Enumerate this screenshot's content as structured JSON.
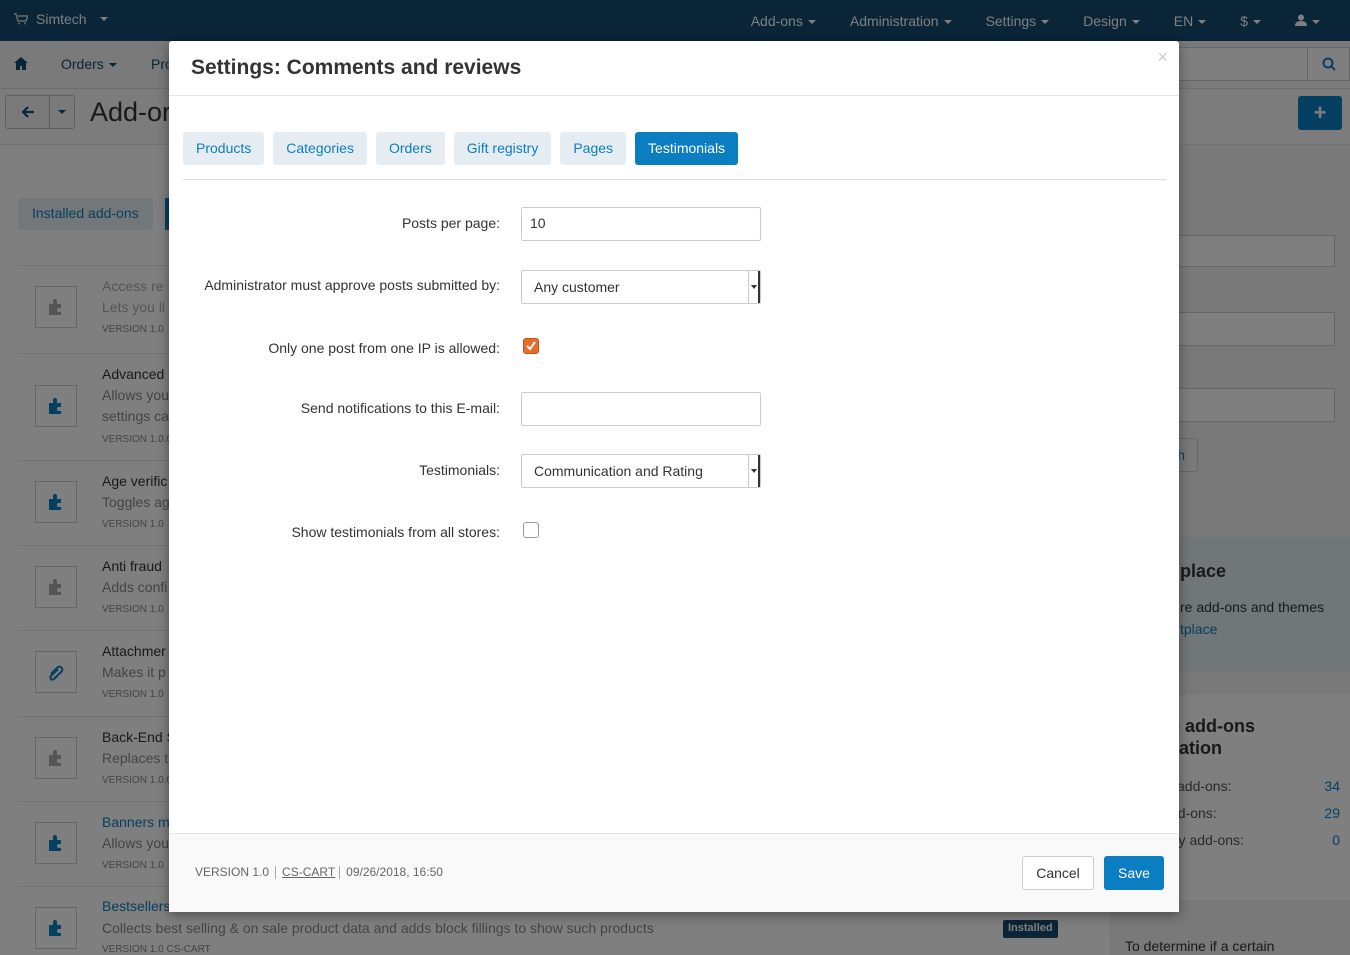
{
  "topbar": {
    "store": "Simtech",
    "menu": [
      "Add-ons",
      "Administration",
      "Settings",
      "Design",
      "EN",
      "$"
    ]
  },
  "nav": {
    "orders": "Orders",
    "products_partial": "Pro"
  },
  "toolbar": {
    "title_partial": "Add-or"
  },
  "background": {
    "installed_tab": "Installed add-ons",
    "addons": [
      {
        "name": "Access re",
        "desc": "Lets you li",
        "version": "VERSION 1.0"
      },
      {
        "name": "Advanced",
        "desc": "Allows you",
        "desc2": "settings ca",
        "version": "VERSION 1.0.0"
      },
      {
        "name": "Age verific",
        "desc": "Toggles ag",
        "version": "VERSION 1.0"
      },
      {
        "name": "Anti fraud",
        "desc": "Adds confi",
        "version": "VERSION 1.0"
      },
      {
        "name": "Attachmer",
        "desc": "Makes it p",
        "version": "VERSION 1.0"
      },
      {
        "name": "Back-End S",
        "desc": "Replaces t",
        "version": "VERSION 1.0.0"
      },
      {
        "name": "Banners m",
        "desc": "Allows you",
        "version": "VERSION 1.0"
      }
    ],
    "bestsellers": {
      "name": "Bestsellers",
      "desc": "Collects best selling & on sale product data and adds block fillings to show such products",
      "version": "VERSION 1.0   CS-CART",
      "badge": "Installed"
    },
    "sidebar": {
      "search_btn": "h",
      "marketplace_title": "place",
      "marketplace_text": "re add-ons and themes",
      "marketplace_link": "tplace",
      "stats_title_1": "e add-ons",
      "stats_title_2": "zation",
      "stats": [
        {
          "label": "l add-ons:",
          "value": "34"
        },
        {
          "label": "dd-ons:",
          "value": "29"
        },
        {
          "label": "rty add-ons:",
          "value": "0"
        }
      ],
      "determine": "To determine if a certain"
    }
  },
  "modal": {
    "title": "Settings: Comments and reviews",
    "close": "×",
    "tabs": [
      "Products",
      "Categories",
      "Orders",
      "Gift registry",
      "Pages",
      "Testimonials"
    ],
    "active_tab": "Testimonials",
    "fields": {
      "posts_per_page_label": "Posts per page:",
      "posts_per_page_value": "10",
      "approve_label": "Administrator must approve posts submitted by:",
      "approve_value": "Any customer",
      "one_ip_label": "Only one post from one IP is allowed:",
      "one_ip_checked": true,
      "email_label": "Send notifications to this E-mail:",
      "email_value": "",
      "testimonials_label": "Testimonials:",
      "testimonials_value": "Communication and Rating",
      "all_stores_label": "Show testimonials from all stores:",
      "all_stores_checked": false
    },
    "footer": {
      "version": "VERSION 1.0",
      "vendor": "CS-CART",
      "date": "09/26/2018, 16:50",
      "cancel": "Cancel",
      "save": "Save"
    }
  }
}
